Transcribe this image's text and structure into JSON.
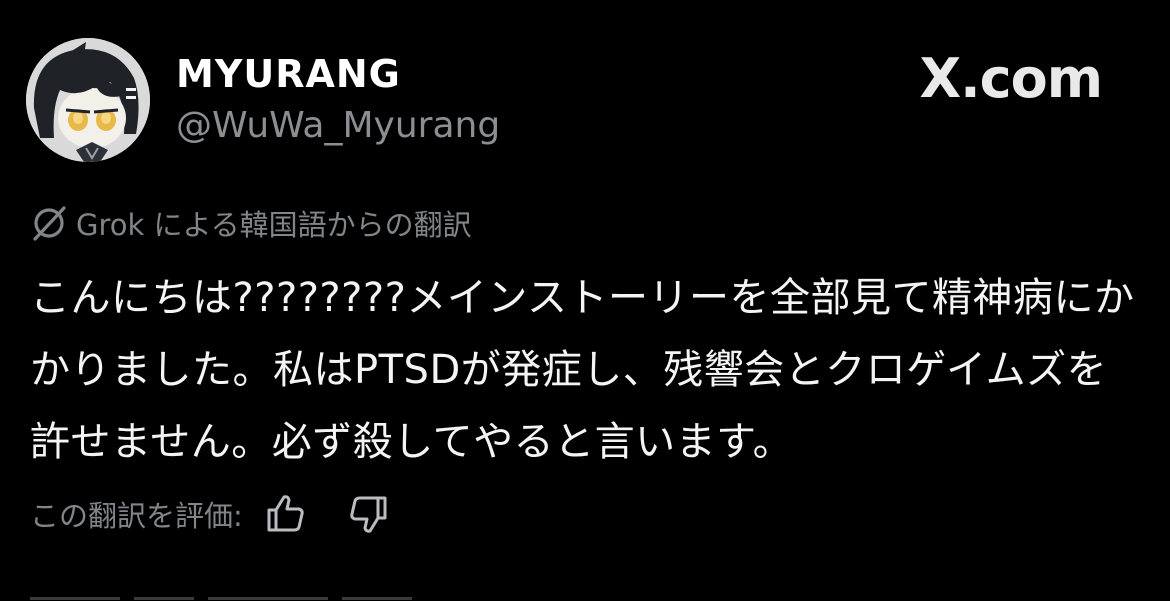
{
  "header": {
    "display_name": "MYURANG",
    "handle": "@WuWa_Myurang",
    "brand": "X.com"
  },
  "translation": {
    "grok_icon": "grok-slash-circle-icon",
    "label": "Grok による韓国語からの翻訳"
  },
  "tweet": {
    "text": "こんにちは????????メインストーリーを全部見て精神病にかかりました。私はPTSDが発症し、残響会とクロゲイムズを許せません。必ず殺してやると言います。"
  },
  "rating": {
    "label": "この翻訳を評価:",
    "thumbs_up_icon": "thumbs-up-icon",
    "thumbs_down_icon": "thumbs-down-icon"
  },
  "colors": {
    "background": "#000000",
    "primary_text": "#f4f4f4",
    "secondary_text": "#8b8f94"
  }
}
